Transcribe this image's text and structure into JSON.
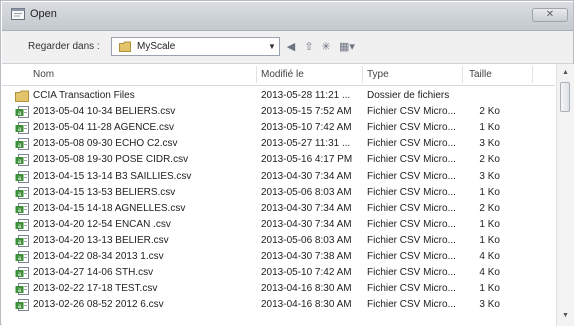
{
  "window": {
    "title": "Open",
    "close_icon": "close-icon"
  },
  "lookin": {
    "label": "Regarder dans :",
    "folder": "MyScale"
  },
  "toolbar": {
    "back": "◀",
    "up": "⇧",
    "newfolder": "✳",
    "view": "▦▾"
  },
  "columns": {
    "name": "Nom",
    "date": "Modifié le",
    "type": "Type",
    "size": "Taille"
  },
  "rows": [
    {
      "name": "CCIA Transaction Files",
      "date": "2013-05-28 11:21 ...",
      "type": "Dossier de fichiers",
      "size": "",
      "kind": "folder"
    },
    {
      "name": "2013-05-04 10-34 BELIERS.csv",
      "date": "2013-05-15 7:52 AM",
      "type": "Fichier CSV Micro...",
      "size": "2 Ko",
      "kind": "csv"
    },
    {
      "name": "2013-05-04 11-28 AGENCE.csv",
      "date": "2013-05-10 7:42 AM",
      "type": "Fichier CSV Micro...",
      "size": "1 Ko",
      "kind": "csv"
    },
    {
      "name": "2013-05-08 09-30 ECHO C2.csv",
      "date": "2013-05-27 11:31 ...",
      "type": "Fichier CSV Micro...",
      "size": "3 Ko",
      "kind": "csv"
    },
    {
      "name": "2013-05-08 19-30 POSE CIDR.csv",
      "date": "2013-05-16 4:17 PM",
      "type": "Fichier CSV Micro...",
      "size": "2 Ko",
      "kind": "csv"
    },
    {
      "name": "2013-04-15 13-14 B3 SAILLIES.csv",
      "date": "2013-04-30 7:34 AM",
      "type": "Fichier CSV Micro...",
      "size": "3 Ko",
      "kind": "csv"
    },
    {
      "name": "2013-04-15 13-53 BELIERS.csv",
      "date": "2013-05-06 8:03 AM",
      "type": "Fichier CSV Micro...",
      "size": "1 Ko",
      "kind": "csv"
    },
    {
      "name": "2013-04-15 14-18 AGNELLES.csv",
      "date": "2013-04-30 7:34 AM",
      "type": "Fichier CSV Micro...",
      "size": "2 Ko",
      "kind": "csv"
    },
    {
      "name": "2013-04-20 12-54 ENCAN .csv",
      "date": "2013-04-30 7:34 AM",
      "type": "Fichier CSV Micro...",
      "size": "1 Ko",
      "kind": "csv"
    },
    {
      "name": "2013-04-20 13-13 BELIER.csv",
      "date": "2013-05-06 8:03 AM",
      "type": "Fichier CSV Micro...",
      "size": "1 Ko",
      "kind": "csv"
    },
    {
      "name": "2013-04-22 08-34 2013 1.csv",
      "date": "2013-04-30 7:38 AM",
      "type": "Fichier CSV Micro...",
      "size": "4 Ko",
      "kind": "csv"
    },
    {
      "name": "2013-04-27 14-06 STH.csv",
      "date": "2013-05-10 7:42 AM",
      "type": "Fichier CSV Micro...",
      "size": "4 Ko",
      "kind": "csv"
    },
    {
      "name": "2013-02-22 17-18 TEST.csv",
      "date": "2013-04-16 8:30 AM",
      "type": "Fichier CSV Micro...",
      "size": "1 Ko",
      "kind": "csv"
    },
    {
      "name": "2013-02-26 08-52 2012 6.csv",
      "date": "2013-04-16 8:30 AM",
      "type": "Fichier CSV Micro...",
      "size": "3 Ko",
      "kind": "csv"
    }
  ],
  "colors": {
    "csv_green": "#3f8f3a",
    "folder_tan": "#e3c46b"
  }
}
